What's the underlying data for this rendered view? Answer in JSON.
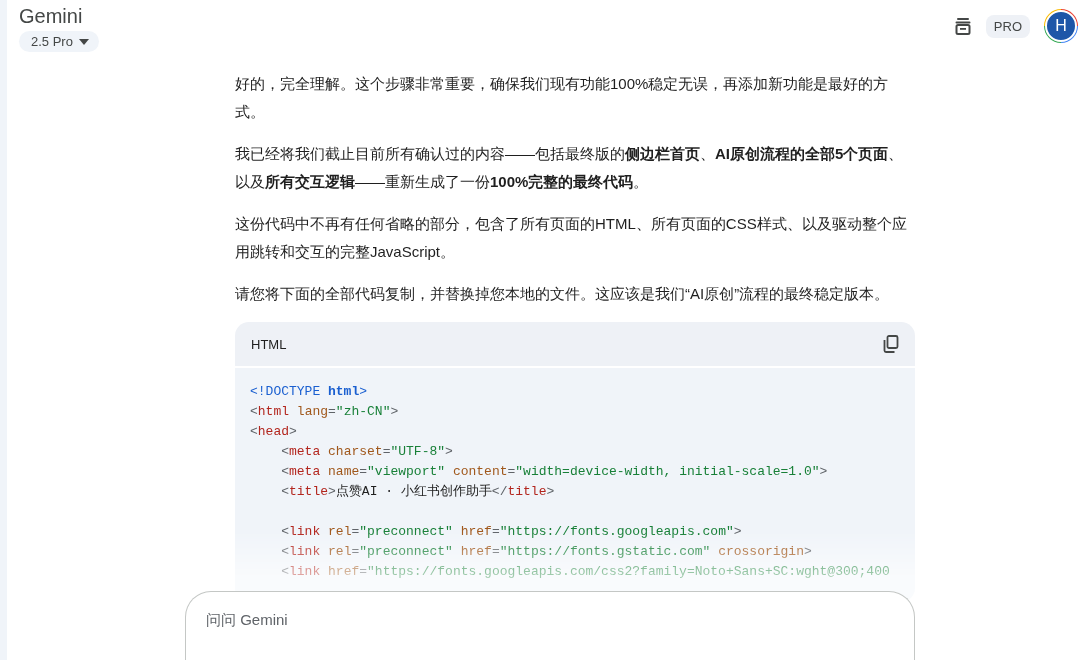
{
  "header": {
    "title": "Gemini",
    "model": "2.5 Pro",
    "badge": "PRO",
    "avatar": "H"
  },
  "paragraphs": [
    "好的，完全理解。这个步骤非常重要，确保我们现有功能100%稳定无误，再添加新功能是最好的方式。",
    "我已经将我们截止目前所有确认过的内容——包括最终版的**侧边栏首页**、**AI原创流程的全部5个页面**、以及**所有交互逻辑**——重新生成了一份**100%完整的最终代码**。",
    "这份代码中不再有任何省略的部分，包含了所有页面的HTML、所有页面的CSS样式、以及驱动整个应用跳转和交互的完整JavaScript。",
    "请您将下面的全部代码复制，并替换掉您本地的文件。这应该是我们“AI原创”流程的最终稳定版本。"
  ],
  "code_block": {
    "language": "HTML",
    "lines": [
      {
        "kind": "code",
        "segments": [
          {
            "kind": "doctype",
            "text": "<!DOCTYPE "
          },
          {
            "kind": "keyword",
            "text": "html"
          },
          {
            "kind": "doctype",
            "text": ">"
          }
        ]
      },
      {
        "kind": "code",
        "segments": [
          {
            "kind": "punct",
            "text": "<"
          },
          {
            "kind": "tag",
            "text": "html"
          },
          {
            "kind": "attr",
            "text": " lang"
          },
          {
            "kind": "punct",
            "text": "="
          },
          {
            "kind": "string",
            "text": "\"zh-CN\""
          },
          {
            "kind": "punct",
            "text": ">"
          }
        ]
      },
      {
        "kind": "code",
        "segments": [
          {
            "kind": "punct",
            "text": "<"
          },
          {
            "kind": "tag",
            "text": "head"
          },
          {
            "kind": "punct",
            "text": ">"
          }
        ]
      },
      {
        "kind": "code",
        "segments": [
          {
            "kind": "punct",
            "text": "    <"
          },
          {
            "kind": "tag",
            "text": "meta"
          },
          {
            "kind": "attr",
            "text": " charset"
          },
          {
            "kind": "punct",
            "text": "="
          },
          {
            "kind": "string",
            "text": "\"UTF-8\""
          },
          {
            "kind": "punct",
            "text": ">"
          }
        ]
      },
      {
        "kind": "code",
        "segments": [
          {
            "kind": "punct",
            "text": "    <"
          },
          {
            "kind": "tag",
            "text": "meta"
          },
          {
            "kind": "attr",
            "text": " name"
          },
          {
            "kind": "punct",
            "text": "="
          },
          {
            "kind": "string",
            "text": "\"viewport\""
          },
          {
            "kind": "attr",
            "text": " content"
          },
          {
            "kind": "punct",
            "text": "="
          },
          {
            "kind": "string",
            "text": "\"width=device-width, initial-scale=1.0\""
          },
          {
            "kind": "punct",
            "text": ">"
          }
        ]
      },
      {
        "kind": "code",
        "segments": [
          {
            "kind": "punct",
            "text": "    <"
          },
          {
            "kind": "tag",
            "text": "title"
          },
          {
            "kind": "punct",
            "text": ">"
          },
          {
            "kind": "text",
            "text": "点赞AI · 小红书创作助手"
          },
          {
            "kind": "punct",
            "text": "</"
          },
          {
            "kind": "tag",
            "text": "title"
          },
          {
            "kind": "punct",
            "text": ">"
          }
        ]
      },
      {
        "kind": "blank"
      },
      {
        "kind": "code",
        "segments": [
          {
            "kind": "punct",
            "text": "    <"
          },
          {
            "kind": "tag",
            "text": "link"
          },
          {
            "kind": "attr",
            "text": " rel"
          },
          {
            "kind": "punct",
            "text": "="
          },
          {
            "kind": "string",
            "text": "\"preconnect\""
          },
          {
            "kind": "attr",
            "text": " href"
          },
          {
            "kind": "punct",
            "text": "="
          },
          {
            "kind": "string",
            "text": "\"https://fonts.googleapis.com\""
          },
          {
            "kind": "punct",
            "text": ">"
          }
        ]
      },
      {
        "kind": "code",
        "segments": [
          {
            "kind": "punct",
            "text": "    <"
          },
          {
            "kind": "tag",
            "text": "link"
          },
          {
            "kind": "attr",
            "text": " rel"
          },
          {
            "kind": "punct",
            "text": "="
          },
          {
            "kind": "string",
            "text": "\"preconnect\""
          },
          {
            "kind": "attr",
            "text": " href"
          },
          {
            "kind": "punct",
            "text": "="
          },
          {
            "kind": "string",
            "text": "\"https://fonts.gstatic.com\""
          },
          {
            "kind": "attr",
            "text": " crossorigin"
          },
          {
            "kind": "punct",
            "text": ">"
          }
        ]
      },
      {
        "kind": "code",
        "segments": [
          {
            "kind": "punct",
            "text": "    <"
          },
          {
            "kind": "tag",
            "text": "link"
          },
          {
            "kind": "attr",
            "text": " href"
          },
          {
            "kind": "punct",
            "text": "="
          },
          {
            "kind": "string",
            "text": "\"https://fonts.googleapis.com/css2?family=Noto+Sans+SC:wght@300;400"
          }
        ]
      }
    ]
  },
  "input": {
    "placeholder": "问问 Gemini"
  }
}
